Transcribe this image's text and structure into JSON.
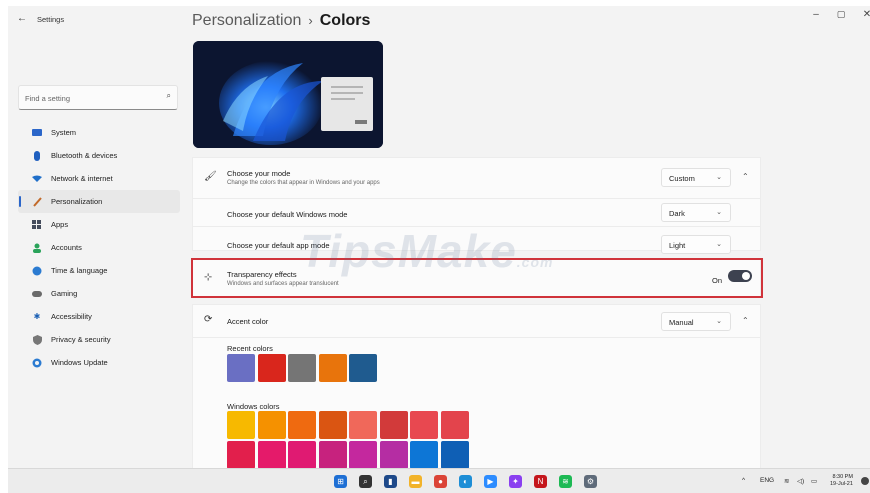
{
  "window": {
    "app_title": "Settings",
    "back_icon": "arrow-left-icon",
    "controls": [
      "–",
      "▢",
      "✕"
    ]
  },
  "search": {
    "placeholder": "Find a setting"
  },
  "sidebar": {
    "items": [
      {
        "label": "System",
        "icon": "monitor-icon",
        "color": "#2b66c9"
      },
      {
        "label": "Bluetooth & devices",
        "icon": "bluetooth-icon",
        "color": "#1f5fbf"
      },
      {
        "label": "Network & internet",
        "icon": "wifi-icon",
        "color": "#1f6fc9"
      },
      {
        "label": "Personalization",
        "icon": "brush-icon",
        "color": "#c26a2a",
        "active": true
      },
      {
        "label": "Apps",
        "icon": "apps-icon",
        "color": "#444c5c"
      },
      {
        "label": "Accounts",
        "icon": "person-icon",
        "color": "#2aa35a"
      },
      {
        "label": "Time & language",
        "icon": "globe-clock-icon",
        "color": "#2b7bd1"
      },
      {
        "label": "Gaming",
        "icon": "gamepad-icon",
        "color": "#555"
      },
      {
        "label": "Accessibility",
        "icon": "accessibility-icon",
        "color": "#1a5fb4"
      },
      {
        "label": "Privacy & security",
        "icon": "shield-icon",
        "color": "#666"
      },
      {
        "label": "Windows Update",
        "icon": "update-icon",
        "color": "#2b7bd1"
      }
    ]
  },
  "breadcrumb": {
    "parent": "Personalization",
    "separator": "›",
    "current": "Colors"
  },
  "mode": {
    "title": "Choose your mode",
    "subtitle": "Change the colors that appear in Windows and your apps",
    "value": "Custom",
    "windows_mode_label": "Choose your default Windows mode",
    "windows_mode_value": "Dark",
    "app_mode_label": "Choose your default app mode",
    "app_mode_value": "Light"
  },
  "transparency": {
    "title": "Transparency effects",
    "subtitle": "Windows and surfaces appear translucent",
    "state_label": "On",
    "enabled": true
  },
  "accent": {
    "title": "Accent color",
    "value": "Manual"
  },
  "recent_colors": {
    "label": "Recent colors",
    "colors": [
      "#6a6fc3",
      "#d9261c",
      "#757575",
      "#e8740c",
      "#1f5b8f"
    ]
  },
  "windows_colors": {
    "label": "Windows colors",
    "row1": [
      "#f7b900",
      "#f59100",
      "#ef6a10",
      "#da5512",
      "#f0685a",
      "#d23a3a",
      "#e84850",
      "#e3444c"
    ],
    "row2": [
      "#e21f4c",
      "#e51a6a",
      "#e01a72",
      "#c7227e",
      "#c4289e",
      "#b52da3",
      "#0d76d6",
      "#0f5fb5"
    ]
  },
  "watermark": {
    "text": "TipsMake",
    "suffix": ".com"
  },
  "taskbar": {
    "icons": [
      {
        "name": "start-icon",
        "color": "#1e6fd4"
      },
      {
        "name": "search-icon",
        "color": "#333"
      },
      {
        "name": "task-view-icon",
        "color": "#1f4a8a"
      },
      {
        "name": "file-explorer-icon",
        "color": "#f2b32a"
      },
      {
        "name": "chrome-icon",
        "color": "#db4437"
      },
      {
        "name": "edge-icon",
        "color": "#1e8ed6"
      },
      {
        "name": "zoom-icon",
        "color": "#2d8cff"
      },
      {
        "name": "messenger-icon",
        "color": "#8a3ff0"
      },
      {
        "name": "netflix-icon",
        "color": "#c4161c"
      },
      {
        "name": "spotify-icon",
        "color": "#1db954"
      },
      {
        "name": "settings-icon",
        "color": "#5f6b7a"
      }
    ],
    "tray_chevron": "^",
    "language": "ENG",
    "time": "8:30 PM",
    "date": "19-Jul-21"
  }
}
